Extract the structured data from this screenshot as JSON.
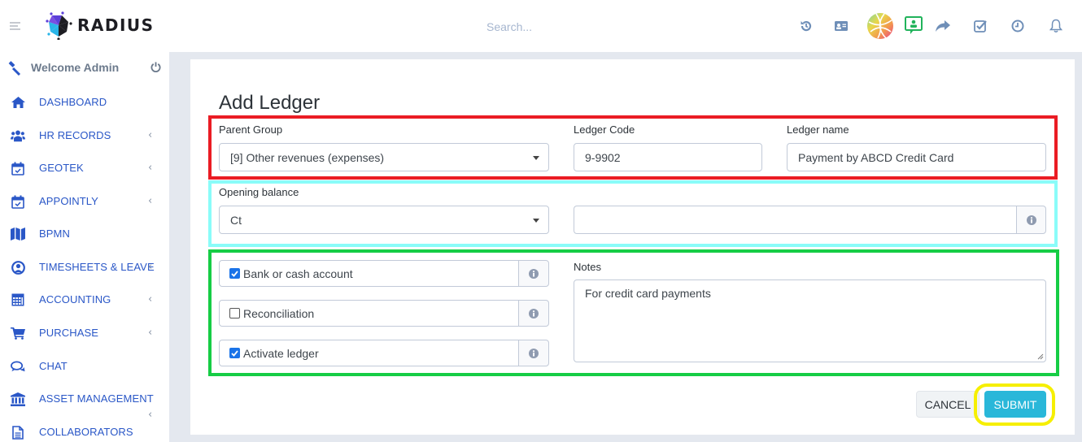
{
  "app": {
    "brand": "RADIUS",
    "search_placeholder": "Search..."
  },
  "header_icons": [
    {
      "name": "history-icon"
    },
    {
      "name": "contact-card-icon"
    },
    {
      "name": "globe-avatar-icon"
    },
    {
      "name": "presentation-user-icon",
      "color": "#21b35b"
    },
    {
      "name": "share-icon"
    },
    {
      "name": "checkbox-tasks-icon"
    },
    {
      "name": "clock-icon"
    },
    {
      "name": "bell-icon"
    }
  ],
  "sidebar": {
    "welcome": "Welcome Admin",
    "items": [
      {
        "label": "DASHBOARD",
        "icon": "home-icon",
        "has_children": false
      },
      {
        "label": "HR RECORDS",
        "icon": "users-icon",
        "has_children": true
      },
      {
        "label": "GEOTEK",
        "icon": "calendar-check-icon",
        "has_children": true
      },
      {
        "label": "APPOINTLY",
        "icon": "calendar-check-icon",
        "has_children": true
      },
      {
        "label": "BPMN",
        "icon": "map-icon",
        "has_children": false
      },
      {
        "label": "TIMESHEETS & LEAVE",
        "icon": "user-circle-icon",
        "has_children": true
      },
      {
        "label": "ACCOUNTING",
        "icon": "calculator-icon",
        "has_children": true
      },
      {
        "label": "PURCHASE",
        "icon": "cart-icon",
        "has_children": true
      },
      {
        "label": "CHAT",
        "icon": "chat-icon",
        "has_children": false
      },
      {
        "label": "ASSET MANAGEMENT",
        "icon": "bank-icon",
        "has_children": true
      },
      {
        "label": "COLLABORATORS",
        "icon": "document-icon",
        "has_children": false
      }
    ],
    "chevron": "‹"
  },
  "form": {
    "title": "Add Ledger",
    "parent_group": {
      "label": "Parent Group",
      "value": "[9] Other revenues (expenses)"
    },
    "ledger_code": {
      "label": "Ledger Code",
      "value": "9-9902"
    },
    "ledger_name": {
      "label": "Ledger name",
      "value": "Payment by ABCD Credit Card"
    },
    "opening_balance": {
      "label": "Opening balance",
      "type_value": "Ct",
      "amount_value": ""
    },
    "checkboxes": [
      {
        "label": "Bank or cash account",
        "checked": true
      },
      {
        "label": "Reconciliation",
        "checked": false
      },
      {
        "label": "Activate ledger",
        "checked": true
      }
    ],
    "notes": {
      "label": "Notes",
      "value": "For credit card payments"
    },
    "cancel_label": "CANCEL",
    "submit_label": "SUBMIT"
  },
  "colors": {
    "accent_blue": "#2a57c7",
    "submit": "#29b7d9",
    "highlight_red": "#ea1c24",
    "highlight_cyan": "#8afcf9",
    "highlight_green": "#16cd45",
    "highlight_yellow": "#f6ef00"
  }
}
